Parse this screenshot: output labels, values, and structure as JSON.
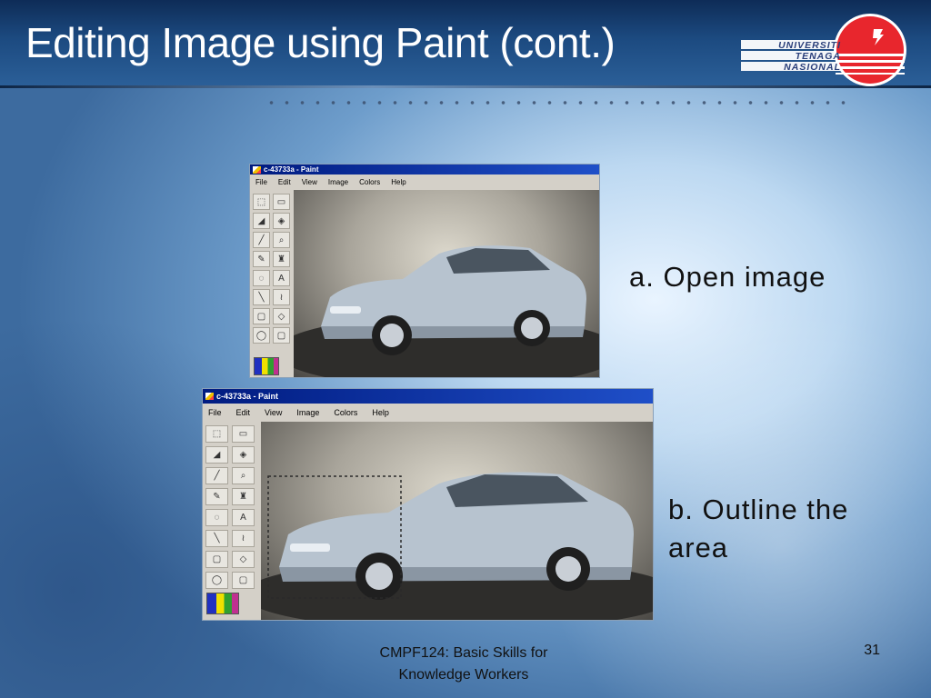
{
  "slide": {
    "title": "Editing Image using Paint (cont.)",
    "logo": {
      "lines": [
        "UNIVERSITI",
        "TENAGA",
        "NASIONAL"
      ],
      "colors": {
        "disc": "#e8262d",
        "text": "#2a3f7a"
      }
    },
    "footer": {
      "course_line1": "CMPF124: Basic Skills for",
      "course_line2": "Knowledge Workers",
      "page_number": "31"
    }
  },
  "step_a": {
    "label": "a. Open image",
    "window": {
      "title": "c-43733a - Paint",
      "menu": [
        "File",
        "Edit",
        "View",
        "Image",
        "Colors",
        "Help"
      ]
    }
  },
  "step_b": {
    "label": "b. Outline the area",
    "window": {
      "title": "c-43733a - Paint",
      "menu": [
        "File",
        "Edit",
        "View",
        "Image",
        "Colors",
        "Help"
      ]
    }
  },
  "icons": {
    "tools": [
      "free-select-icon",
      "rect-select-icon",
      "eraser-icon",
      "fill-icon",
      "color-picker-icon",
      "magnifier-icon",
      "pencil-icon",
      "brush-icon",
      "airbrush-icon",
      "text-icon",
      "line-icon",
      "curve-icon",
      "rectangle-icon",
      "polygon-icon",
      "ellipse-icon",
      "rounded-rect-icon"
    ],
    "tool_glyphs": [
      "⬚",
      "▭",
      "◢",
      "◈",
      "╱",
      "⌕",
      "✎",
      "♜",
      "◌",
      "A",
      "╲",
      "≀",
      "▢",
      "◇",
      "◯",
      "▢"
    ]
  }
}
